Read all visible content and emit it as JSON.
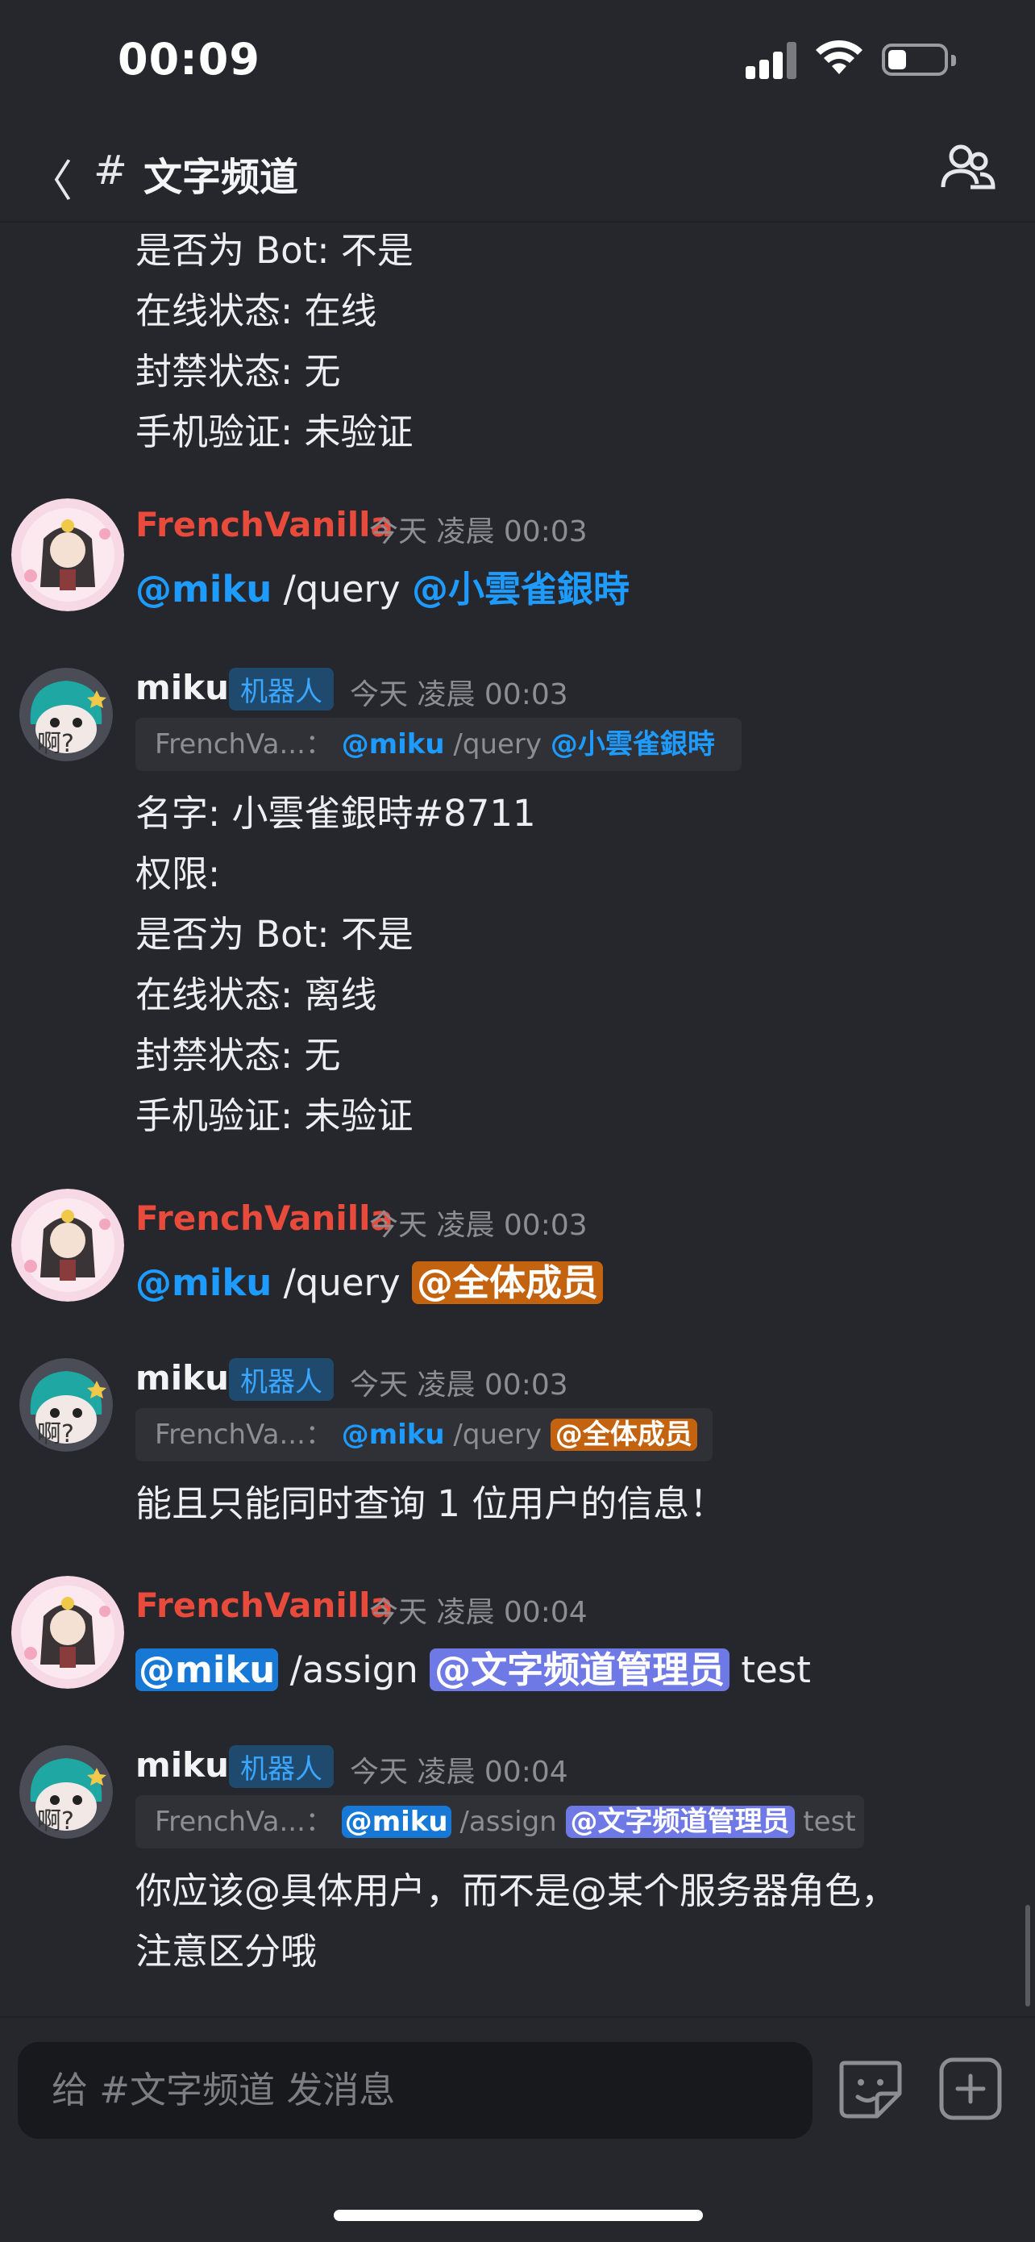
{
  "status_bar": {
    "time": "00:09"
  },
  "header": {
    "back_label": "〈",
    "hash": "#",
    "channel_name": "文字频道"
  },
  "top_fragment": [
    "是否为 Bot: 不是",
    "在线状态: 在线",
    "封禁状态: 无",
    "手机验证: 未验证"
  ],
  "messages": [
    {
      "author": "FrenchVanilla",
      "time": "今天 凌晨 00:03",
      "mention": "@miku",
      "command": " /query ",
      "target": "@小雲雀銀時"
    },
    {
      "author": "miku",
      "badge": "机器人",
      "time": "今天 凌晨 00:03",
      "reply_author": "FrenchVa...：",
      "reply_mention": "@miku",
      "reply_command": " /query ",
      "reply_target": "@小雲雀銀時",
      "lines": [
        "名字: 小雲雀銀時#8711",
        "权限:",
        "是否为 Bot: 不是",
        "在线状态: 离线",
        "封禁状态: 无",
        "手机验证: 未验证"
      ]
    },
    {
      "author": "FrenchVanilla",
      "time": "今天 凌晨 00:03",
      "mention": "@miku",
      "command": " /query ",
      "target": "@全体成员"
    },
    {
      "author": "miku",
      "badge": "机器人",
      "time": "今天 凌晨 00:03",
      "reply_author": "FrenchVa...：",
      "reply_mention": "@miku",
      "reply_command": " /query ",
      "reply_target": "@全体成员",
      "lines": [
        "能且只能同时查询 1 位用户的信息！"
      ]
    },
    {
      "author": "FrenchVanilla",
      "time": "今天 凌晨 00:04",
      "mention": "@miku",
      "command": " /assign ",
      "target": "@文字频道管理员",
      "suffix": " test"
    },
    {
      "author": "miku",
      "badge": "机器人",
      "time": "今天 凌晨 00:04",
      "reply_author": "FrenchVa...：",
      "reply_mention": "@miku",
      "reply_command": " /assign ",
      "reply_target": "@文字频道管理员",
      "reply_suffix": " test",
      "lines": [
        "你应该@具体用户，而不是@某个服务器角色，",
        "注意区分哦"
      ]
    }
  ],
  "composer": {
    "placeholder": "给 #文字频道 发消息"
  },
  "icons": [
    "back-icon",
    "hash-icon",
    "members-icon",
    "sticker-icon",
    "plus-icon",
    "signal-icon",
    "wifi-icon",
    "battery-icon"
  ]
}
